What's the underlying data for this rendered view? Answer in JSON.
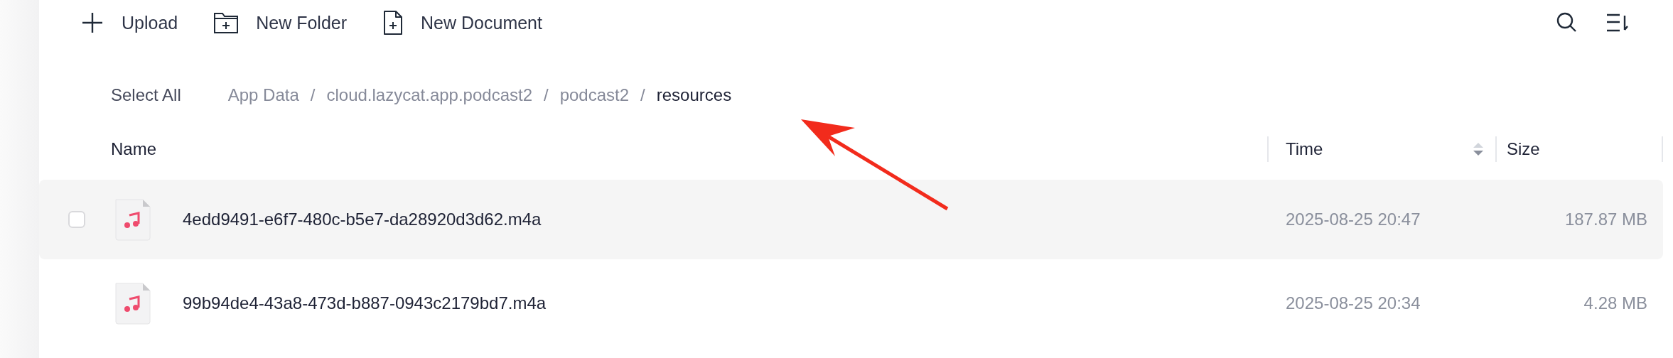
{
  "toolbar": {
    "actions": [
      {
        "kind": "upload",
        "label": "Upload"
      },
      {
        "kind": "folder",
        "label": "New Folder"
      },
      {
        "kind": "document",
        "label": "New Document"
      }
    ]
  },
  "select_all": "Select All",
  "breadcrumb": {
    "separator": "/",
    "items": [
      {
        "label": "App Data",
        "current": false
      },
      {
        "label": "cloud.lazycat.app.podcast2",
        "current": false
      },
      {
        "label": "podcast2",
        "current": false
      },
      {
        "label": "resources",
        "current": true
      }
    ]
  },
  "table": {
    "columns": [
      {
        "label": "Name",
        "kind": "text"
      },
      {
        "label": "Time",
        "kind": "sorted"
      },
      {
        "label": "Size",
        "kind": "text"
      }
    ],
    "rows": [
      {
        "name": "4edd9491-e6f7-480c-b5e7-da28920d3d62.m4a",
        "time": "2025-08-25 20:47",
        "size": "187.87 MB",
        "hovered": true,
        "checked": false
      },
      {
        "name": "99b94de4-43a8-473d-b887-0943c2179bd7.m4a",
        "time": "2025-08-25 20:34",
        "size": "4.28 MB",
        "hovered": false,
        "checked": false
      }
    ]
  },
  "annotation": {
    "kind": "arrow"
  }
}
